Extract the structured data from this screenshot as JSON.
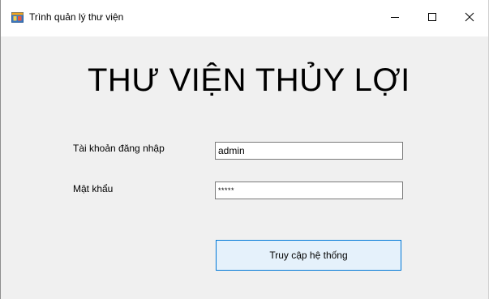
{
  "window": {
    "title": "Trình quản lý thư viện",
    "icon": "app-window-icon"
  },
  "caption_buttons": {
    "minimize_icon": "minimize-icon",
    "maximize_icon": "maximize-icon",
    "close_icon": "close-icon"
  },
  "main": {
    "heading": "THƯ VIỆN THỦY LỢI",
    "username_label": "Tài khoản đăng nhập",
    "username_value": "admin",
    "password_label": "Mật khẩu",
    "password_display": "*****",
    "submit_label": "Truy cập hệ thống"
  },
  "colors": {
    "client_background": "#f0f0f0",
    "titlebar_background": "#ffffff",
    "button_border": "#0078d7",
    "button_background": "#e5f1fb"
  }
}
